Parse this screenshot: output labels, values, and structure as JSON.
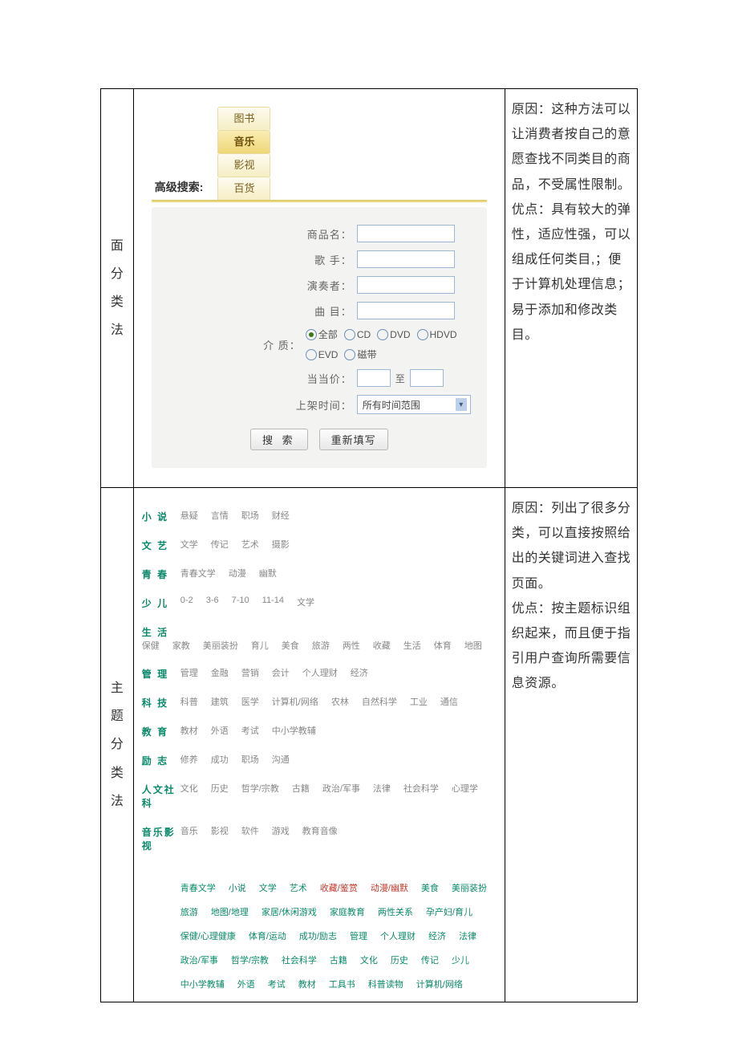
{
  "row1": {
    "label": [
      "面",
      "分",
      "类",
      "法"
    ],
    "desc": "原因：这种方法可以让消费者按自己的意愿查找不同类目的商品，不受属性限制。\n优点：具有较大的弹性，适应性强，可以组成任何类目,；便于计算机处理信息；易于添加和修改类目。",
    "search": {
      "title": "高级搜索:",
      "tabs": [
        "图书",
        "音乐",
        "影视",
        "百货"
      ],
      "active_tab": 1,
      "fields": {
        "product": "商品名：",
        "singer": "歌 手：",
        "player": "演奏者：",
        "track": "曲 目：",
        "media": "介 质：",
        "price": "当当价：",
        "price_to": "至",
        "time": "上架时间：",
        "time_select": "所有时间范围"
      },
      "media_options": [
        "全部",
        "CD",
        "DVD",
        "HDVD",
        "EVD",
        "磁带"
      ],
      "media_selected": 0,
      "buttons": {
        "search": "搜 索",
        "reset": "重新填写"
      }
    }
  },
  "row2": {
    "label": [
      "主",
      "题",
      "分",
      "类",
      "法"
    ],
    "desc": "原因：列出了很多分类，可以直接按照给出的关键词进入查找页面。\n优点：按主题标识组织起来，而且便于指引用户查询所需要信息资源。",
    "categories": [
      {
        "head": "小 说",
        "items": [
          "悬疑",
          "言情",
          "职场",
          "财经"
        ]
      },
      {
        "head": "文 艺",
        "items": [
          "文学",
          "传记",
          "艺术",
          "摄影"
        ]
      },
      {
        "head": "青 春",
        "items": [
          "青春文学",
          "动漫",
          "幽默"
        ]
      },
      {
        "head": "少 儿",
        "items": [
          "0-2",
          "3-6",
          "7-10",
          "11-14",
          "文学"
        ]
      },
      {
        "head": "生 活",
        "items": [
          "保健",
          "家教",
          "美丽装扮",
          "育儿",
          "美食",
          "旅游",
          "两性",
          "收藏",
          "生活",
          "体育",
          "地图"
        ]
      },
      {
        "head": "管 理",
        "items": [
          "管理",
          "金融",
          "营销",
          "会计",
          "个人理财",
          "经济"
        ]
      },
      {
        "head": "科 技",
        "items": [
          "科普",
          "建筑",
          "医学",
          "计算机/网络",
          "农林",
          "自然科学",
          "工业",
          "通信"
        ]
      },
      {
        "head": "教 育",
        "items": [
          "教材",
          "外语",
          "考试",
          "中小学教辅"
        ]
      },
      {
        "head": "励 志",
        "items": [
          "修养",
          "成功",
          "职场",
          "沟通"
        ]
      },
      {
        "head": "人文社科",
        "items": [
          "文化",
          "历史",
          "哲学/宗教",
          "古籍",
          "政治/军事",
          "法律",
          "社会科学",
          "心理学"
        ]
      },
      {
        "head": "音乐影视",
        "items": [
          "音乐",
          "影视",
          "软件",
          "游戏",
          "教育音像"
        ]
      }
    ],
    "tags": [
      {
        "t": "青春文学"
      },
      {
        "t": "小说"
      },
      {
        "t": "文学"
      },
      {
        "t": "艺术"
      },
      {
        "t": "收藏/鉴赏",
        "a": 1
      },
      {
        "t": "动漫/幽默",
        "a": 1
      },
      {
        "t": "美食"
      },
      {
        "t": "美丽装扮"
      },
      {
        "t": "旅游"
      },
      {
        "t": "地图/地理"
      },
      {
        "t": "家居/休闲游戏"
      },
      {
        "t": "家庭教育"
      },
      {
        "t": "两性关系"
      },
      {
        "t": "孕产妇/育儿"
      },
      {
        "t": "保健/心理健康"
      },
      {
        "t": "体育/运动"
      },
      {
        "t": "成功/励志"
      },
      {
        "t": "管理"
      },
      {
        "t": "个人理财"
      },
      {
        "t": "经济"
      },
      {
        "t": "法律"
      },
      {
        "t": "政治/军事"
      },
      {
        "t": "哲学/宗教"
      },
      {
        "t": "社会科学"
      },
      {
        "t": "古籍"
      },
      {
        "t": "文化"
      },
      {
        "t": "历史"
      },
      {
        "t": "传记"
      },
      {
        "t": "少儿"
      },
      {
        "t": "中小学教辅"
      },
      {
        "t": "外语"
      },
      {
        "t": "考试"
      },
      {
        "t": "教材"
      },
      {
        "t": "工具书"
      },
      {
        "t": "科普读物"
      },
      {
        "t": "计算机/网络"
      }
    ]
  }
}
